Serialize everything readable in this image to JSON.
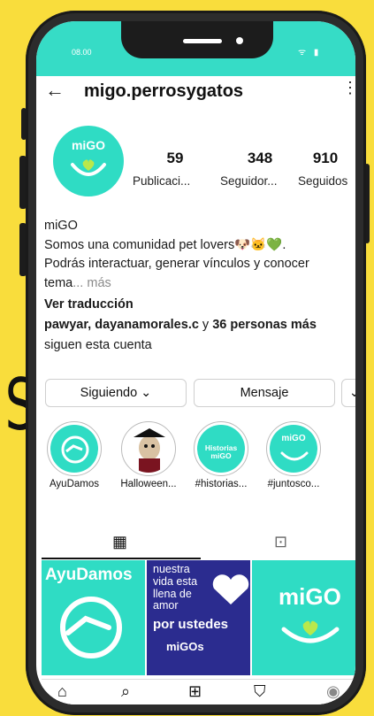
{
  "status_bar": {
    "time": "08.00",
    "icons": "ᯤ ▮"
  },
  "header": {
    "back_icon": "←",
    "username": "migo.perrosygatos",
    "more_icon": "⋮"
  },
  "profile": {
    "avatar_text": "miGO",
    "stats": [
      {
        "value": "59",
        "label": "Publicaci..."
      },
      {
        "value": "348",
        "label": "Seguidor..."
      },
      {
        "value": "910",
        "label": "Seguidos"
      }
    ],
    "name": "miGO",
    "bio_line1": "Somos una comunidad pet lovers🐶🐱💚.",
    "bio_line2": "Podrás interactuar, generar vínculos y conocer",
    "bio_line3_start": "tema",
    "bio_more": "... más",
    "translate": "Ver traducción",
    "followers_bold": "pawyar, dayanamorales.c",
    "followers_mid": " y ",
    "followers_count": "36 personas más",
    "followers_end": "siguen esta cuenta"
  },
  "buttons": {
    "following": "Siguiendo ⌄",
    "message": "Mensaje",
    "more": "⌄"
  },
  "highlights": [
    {
      "label": "AyuDamos"
    },
    {
      "label": "Halloween..."
    },
    {
      "label": "#historias...",
      "inner_text": "Historias miGO"
    },
    {
      "label": "#juntosco...",
      "inner_text": "miGO"
    }
  ],
  "tabs": {
    "grid_icon": "▦",
    "tagged_icon": "⊡"
  },
  "posts": [
    {
      "title": "AyuDamos"
    },
    {
      "lines": [
        "nuestra",
        "vida esta",
        "llena de",
        "amor"
      ],
      "bold": "por ustedes",
      "tag": "miGOs"
    },
    {
      "title": "miGO"
    }
  ],
  "nav": {
    "home": "⌂",
    "search": "⌕",
    "add": "⊞",
    "shop": "⛉",
    "profile": "◉"
  },
  "colors": {
    "background": "#f9dd3c",
    "brand_teal": "#2fdcc4",
    "post_blue": "#2b2c8f"
  }
}
